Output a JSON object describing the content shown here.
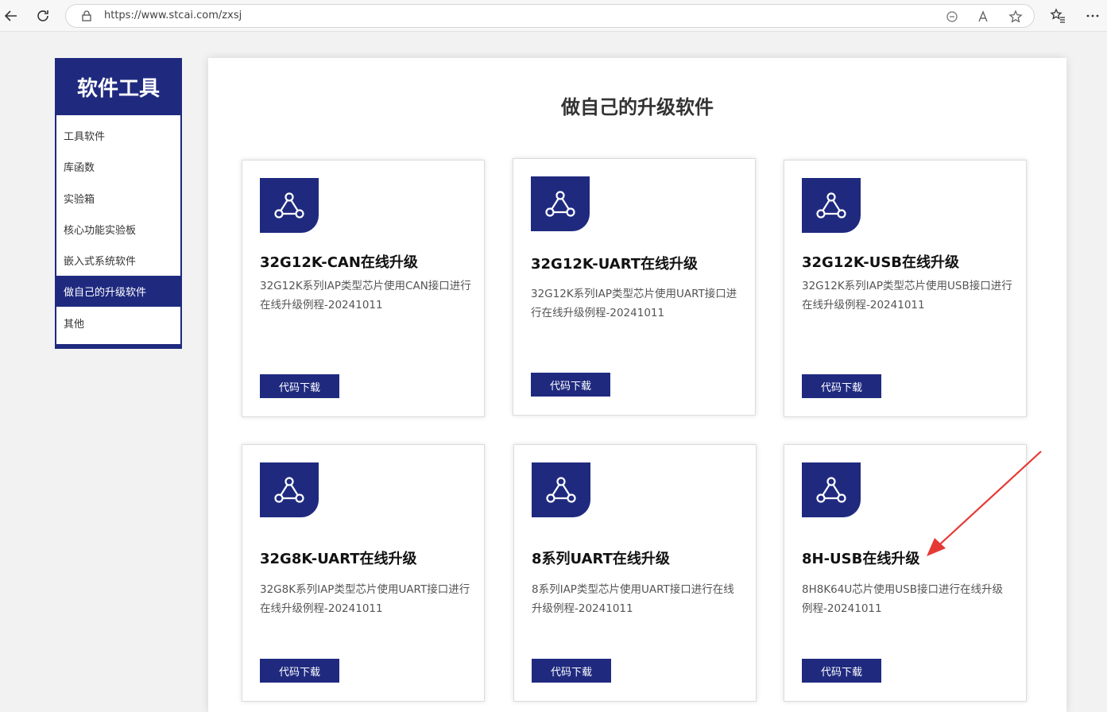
{
  "browser": {
    "url": "https://www.stcai.com/zxsj"
  },
  "sidebar": {
    "title": "软件工具",
    "items": [
      {
        "label": "工具软件",
        "active": false
      },
      {
        "label": "库函数",
        "active": false
      },
      {
        "label": "实验箱",
        "active": false
      },
      {
        "label": "核心功能实验板",
        "active": false
      },
      {
        "label": "嵌入式系统软件",
        "active": false
      },
      {
        "label": "做自己的升级软件",
        "active": true
      },
      {
        "label": "其他",
        "active": false
      }
    ]
  },
  "main": {
    "title": "做自己的升级软件",
    "cards": [
      {
        "title": "32G12K-CAN在线升级",
        "desc": "32G12K系列IAP类型芯片使用CAN接口进行在线升级例程-20241011",
        "button": "代码下载",
        "icon": "share-nodes-icon"
      },
      {
        "title": "32G12K-UART在线升级",
        "desc": "32G12K系列IAP类型芯片使用UART接口进行在线升级例程-20241011",
        "button": "代码下载",
        "icon": "share-nodes-icon"
      },
      {
        "title": "32G12K-USB在线升级",
        "desc": "32G12K系列IAP类型芯片使用USB接口进行在线升级例程-20241011",
        "button": "代码下载",
        "icon": "share-nodes-icon"
      },
      {
        "title": "32G8K-UART在线升级",
        "desc": "32G8K系列IAP类型芯片使用UART接口进行在线升级例程-20241011",
        "button": "代码下载",
        "icon": "share-nodes-icon"
      },
      {
        "title": "8系列UART在线升级",
        "desc": "8系列IAP类型芯片使用UART接口进行在线升级例程-20241011",
        "button": "代码下载",
        "icon": "share-nodes-icon"
      },
      {
        "title": "8H-USB在线升级",
        "desc": "8H8K64U芯片使用USB接口进行在线升级例程-20241011",
        "button": "代码下载",
        "icon": "share-nodes-icon"
      }
    ]
  },
  "colors": {
    "brand": "#1f2a7f",
    "annotation_arrow": "#e53935"
  }
}
